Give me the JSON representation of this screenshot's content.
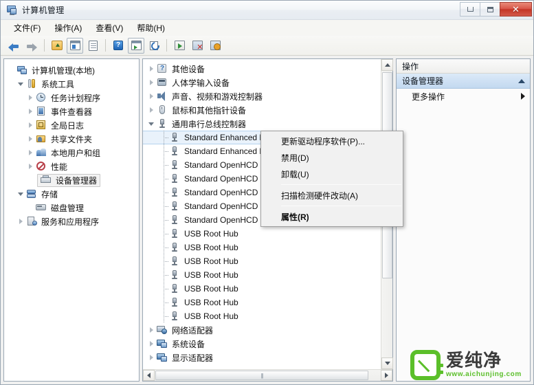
{
  "window": {
    "title": "计算机管理",
    "icon": "computer-management-icon",
    "buttons": {
      "minimize": "最小化",
      "maximize": "最大化",
      "close": "关闭"
    }
  },
  "menubar": {
    "items": [
      {
        "label": "文件(F)",
        "name": "menu-file"
      },
      {
        "label": "操作(A)",
        "name": "menu-action"
      },
      {
        "label": "查看(V)",
        "name": "menu-view"
      },
      {
        "label": "帮助(H)",
        "name": "menu-help"
      }
    ]
  },
  "toolbar": {
    "buttons": [
      {
        "name": "back-arrow-icon",
        "tip": "后退"
      },
      {
        "name": "forward-arrow-icon",
        "tip": "前进"
      },
      {
        "name": "folder-up-icon",
        "tip": "向上一层"
      },
      {
        "name": "show-tree-icon",
        "tip": "显示/隐藏控制台树"
      },
      {
        "name": "properties-icon",
        "tip": "属性"
      },
      {
        "name": "help-icon",
        "tip": "帮助"
      },
      {
        "name": "console-icon",
        "tip": "控制台"
      },
      {
        "name": "refresh-icon",
        "tip": "刷新"
      },
      {
        "name": "export-icon",
        "tip": "导出列表"
      },
      {
        "name": "uninstall-icon",
        "tip": "卸载"
      },
      {
        "name": "update-driver-icon",
        "tip": "更新驱动程序"
      }
    ]
  },
  "sidebar": {
    "items": [
      {
        "label": "计算机管理(本地)",
        "indent": 0,
        "twisty": "none",
        "icon": "computer-icon",
        "selected": false
      },
      {
        "label": "系统工具",
        "indent": 1,
        "twisty": "open",
        "icon": "tools-icon",
        "selected": false
      },
      {
        "label": "任务计划程序",
        "indent": 2,
        "twisty": "closed",
        "icon": "clock-icon",
        "selected": false
      },
      {
        "label": "事件查看器",
        "indent": 2,
        "twisty": "closed",
        "icon": "event-viewer-icon",
        "selected": false
      },
      {
        "label": "全局日志",
        "indent": 2,
        "twisty": "closed",
        "icon": "log-icon",
        "selected": false
      },
      {
        "label": "共享文件夹",
        "indent": 2,
        "twisty": "closed",
        "icon": "shared-folder-icon",
        "selected": false
      },
      {
        "label": "本地用户和组",
        "indent": 2,
        "twisty": "closed",
        "icon": "users-icon",
        "selected": false
      },
      {
        "label": "性能",
        "indent": 2,
        "twisty": "closed",
        "icon": "performance-icon",
        "selected": false
      },
      {
        "label": "设备管理器",
        "indent": 2,
        "twisty": "none",
        "icon": "device-manager-icon",
        "selected": true
      },
      {
        "label": "存储",
        "indent": 1,
        "twisty": "open",
        "icon": "storage-icon",
        "selected": false
      },
      {
        "label": "磁盘管理",
        "indent": 2,
        "twisty": "none",
        "icon": "disk-management-icon",
        "selected": false
      },
      {
        "label": "服务和应用程序",
        "indent": 1,
        "twisty": "closed",
        "icon": "services-icon",
        "selected": false
      }
    ]
  },
  "device_tree": {
    "items": [
      {
        "label": "其他设备",
        "level": 1,
        "twisty": "closed",
        "icon": "other-device-icon",
        "selected": false
      },
      {
        "label": "人体学输入设备",
        "level": 1,
        "twisty": "closed",
        "icon": "hid-icon",
        "selected": false
      },
      {
        "label": "声音、视频和游戏控制器",
        "level": 1,
        "twisty": "closed",
        "icon": "sound-icon",
        "selected": false
      },
      {
        "label": "鼠标和其他指针设备",
        "level": 1,
        "twisty": "closed",
        "icon": "mouse-icon",
        "selected": false
      },
      {
        "label": "通用串行总线控制器",
        "level": 1,
        "twisty": "open",
        "icon": "usb-icon",
        "selected": false
      },
      {
        "label": "Standard Enhanced PCI to USB Host Controller",
        "level": 2,
        "twisty": "none",
        "icon": "usb-icon",
        "selected": true
      },
      {
        "label": "Standard Enhanced PCI to USB Host Controller",
        "level": 2,
        "twisty": "none",
        "icon": "usb-icon",
        "selected": false
      },
      {
        "label": "Standard OpenHCD USB Host Controller",
        "level": 2,
        "twisty": "none",
        "icon": "usb-icon",
        "selected": false
      },
      {
        "label": "Standard OpenHCD USB Host Controller",
        "level": 2,
        "twisty": "none",
        "icon": "usb-icon",
        "selected": false
      },
      {
        "label": "Standard OpenHCD USB Host Controller",
        "level": 2,
        "twisty": "none",
        "icon": "usb-icon",
        "selected": false
      },
      {
        "label": "Standard OpenHCD USB Host Controller",
        "level": 2,
        "twisty": "none",
        "icon": "usb-icon",
        "selected": false
      },
      {
        "label": "Standard OpenHCD USB Host Controller",
        "level": 2,
        "twisty": "none",
        "icon": "usb-icon",
        "selected": false
      },
      {
        "label": "USB Root Hub",
        "level": 2,
        "twisty": "none",
        "icon": "usb-icon",
        "selected": false
      },
      {
        "label": "USB Root Hub",
        "level": 2,
        "twisty": "none",
        "icon": "usb-icon",
        "selected": false
      },
      {
        "label": "USB Root Hub",
        "level": 2,
        "twisty": "none",
        "icon": "usb-icon",
        "selected": false
      },
      {
        "label": "USB Root Hub",
        "level": 2,
        "twisty": "none",
        "icon": "usb-icon",
        "selected": false
      },
      {
        "label": "USB Root Hub",
        "level": 2,
        "twisty": "none",
        "icon": "usb-icon",
        "selected": false
      },
      {
        "label": "USB Root Hub",
        "level": 2,
        "twisty": "none",
        "icon": "usb-icon",
        "selected": false
      },
      {
        "label": "USB Root Hub",
        "level": 2,
        "twisty": "none",
        "icon": "usb-icon",
        "selected": false
      },
      {
        "label": "网络适配器",
        "level": 1,
        "twisty": "closed",
        "icon": "network-icon",
        "selected": false
      },
      {
        "label": "系统设备",
        "level": 1,
        "twisty": "closed",
        "icon": "system-device-icon",
        "selected": false
      },
      {
        "label": "显示适配器",
        "level": 1,
        "twisty": "closed",
        "icon": "display-icon",
        "selected": false
      }
    ]
  },
  "context_menu": {
    "items": [
      {
        "label": "更新驱动程序软件(P)...",
        "type": "item",
        "bold": false,
        "name": "ctx-update-driver"
      },
      {
        "label": "禁用(D)",
        "type": "item",
        "bold": false,
        "name": "ctx-disable"
      },
      {
        "label": "卸载(U)",
        "type": "item",
        "bold": false,
        "name": "ctx-uninstall"
      },
      {
        "label": "",
        "type": "separator",
        "bold": false,
        "name": "ctx-separator-1"
      },
      {
        "label": "扫描检测硬件改动(A)",
        "type": "item",
        "bold": false,
        "name": "ctx-scan-hardware"
      },
      {
        "label": "",
        "type": "separator",
        "bold": false,
        "name": "ctx-separator-2"
      },
      {
        "label": "属性(R)",
        "type": "item",
        "bold": true,
        "name": "ctx-properties"
      }
    ]
  },
  "actions_pane": {
    "header": "操作",
    "section_title": "设备管理器",
    "items": [
      {
        "label": "更多操作",
        "submenu": true
      }
    ]
  },
  "watermark": {
    "brand": "爱纯净",
    "url": "www.aichunjing.com",
    "color": "#5bbf2a"
  },
  "colors": {
    "titlebar_close": "#c43525",
    "selection_blue": "#e9f2fb",
    "section_blue": "#cfe1f4",
    "accent_green": "#5bbf2a"
  }
}
